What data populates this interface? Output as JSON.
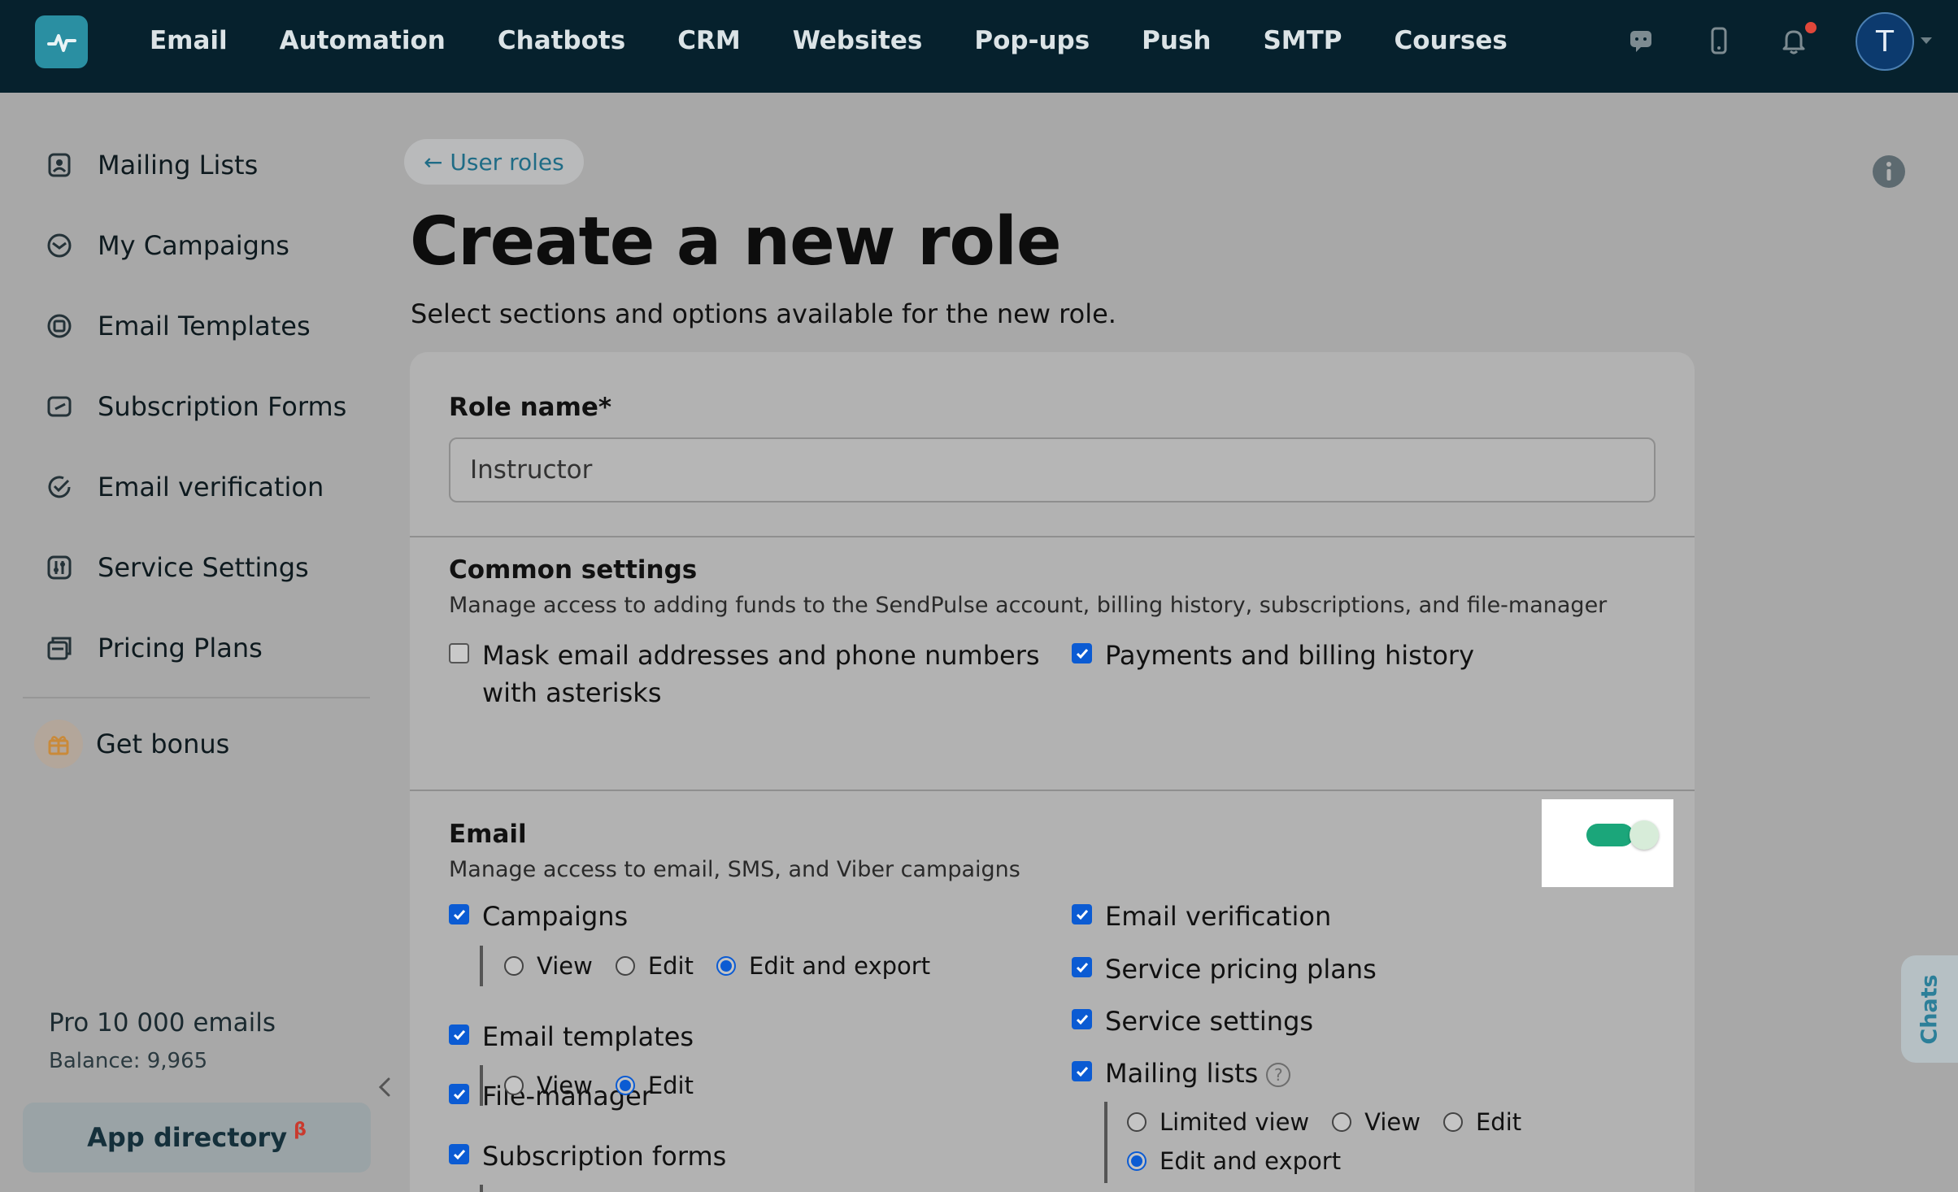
{
  "topnav": {
    "items": [
      "Email",
      "Automation",
      "Chatbots",
      "CRM",
      "Websites",
      "Pop-ups",
      "Push",
      "SMTP",
      "Courses"
    ],
    "avatar_letter": "T",
    "icons": [
      "chat-icon",
      "mobile-icon",
      "bell-icon"
    ]
  },
  "sidebar": {
    "items": [
      {
        "label": "Mailing Lists",
        "icon": "mailing-lists-icon"
      },
      {
        "label": "My Campaigns",
        "icon": "campaigns-icon"
      },
      {
        "label": "Email Templates",
        "icon": "templates-icon"
      },
      {
        "label": "Subscription Forms",
        "icon": "forms-icon"
      },
      {
        "label": "Email verification",
        "icon": "verification-icon"
      },
      {
        "label": "Service Settings",
        "icon": "settings-icon"
      },
      {
        "label": "Pricing Plans",
        "icon": "pricing-icon"
      }
    ],
    "bonus_label": "Get bonus",
    "plan_name": "Pro 10 000 emails",
    "balance": "Balance: 9,965",
    "app_directory": "App directory",
    "app_directory_badge": "β"
  },
  "main": {
    "back_label": "← User roles",
    "title": "Create a new role",
    "subtitle": "Select sections and options available for the new role.",
    "role_name_label": "Role name*",
    "role_name_value": "Instructor",
    "common": {
      "title": "Common settings",
      "desc": "Manage access to adding funds to the SendPulse account, billing history, subscriptions, and file-manager",
      "mask_line1": "Mask email addresses and phone numbers",
      "mask_line2": "with asterisks",
      "mask_checked": false,
      "payments": "Payments and billing history",
      "payments_checked": true,
      "file_manager": "File-manager",
      "file_manager_checked": true
    },
    "email": {
      "title": "Email",
      "desc": "Manage access to email, SMS, and Viber campaigns",
      "enabled": true,
      "campaigns": "Campaigns",
      "campaigns_options": [
        "View",
        "Edit",
        "Edit and export"
      ],
      "campaigns_selected": "Edit and export",
      "templates": "Email templates",
      "templates_options": [
        "View",
        "Edit"
      ],
      "templates_selected": "Edit",
      "subscription_forms": "Subscription forms",
      "email_verification": "Email verification",
      "service_pricing_plans": "Service pricing plans",
      "service_settings": "Service settings",
      "mailing_lists": "Mailing lists",
      "mailing_options_row1": [
        "Limited view",
        "View",
        "Edit"
      ],
      "mailing_option_row2": "Edit and export",
      "mailing_selected": "Edit and export"
    }
  },
  "chats_tab": "Chats",
  "colors": {
    "topbar": "#06212d",
    "accent": "#0b5bd3",
    "toggle_on": "#1ba67a",
    "link": "#1f6c86"
  }
}
